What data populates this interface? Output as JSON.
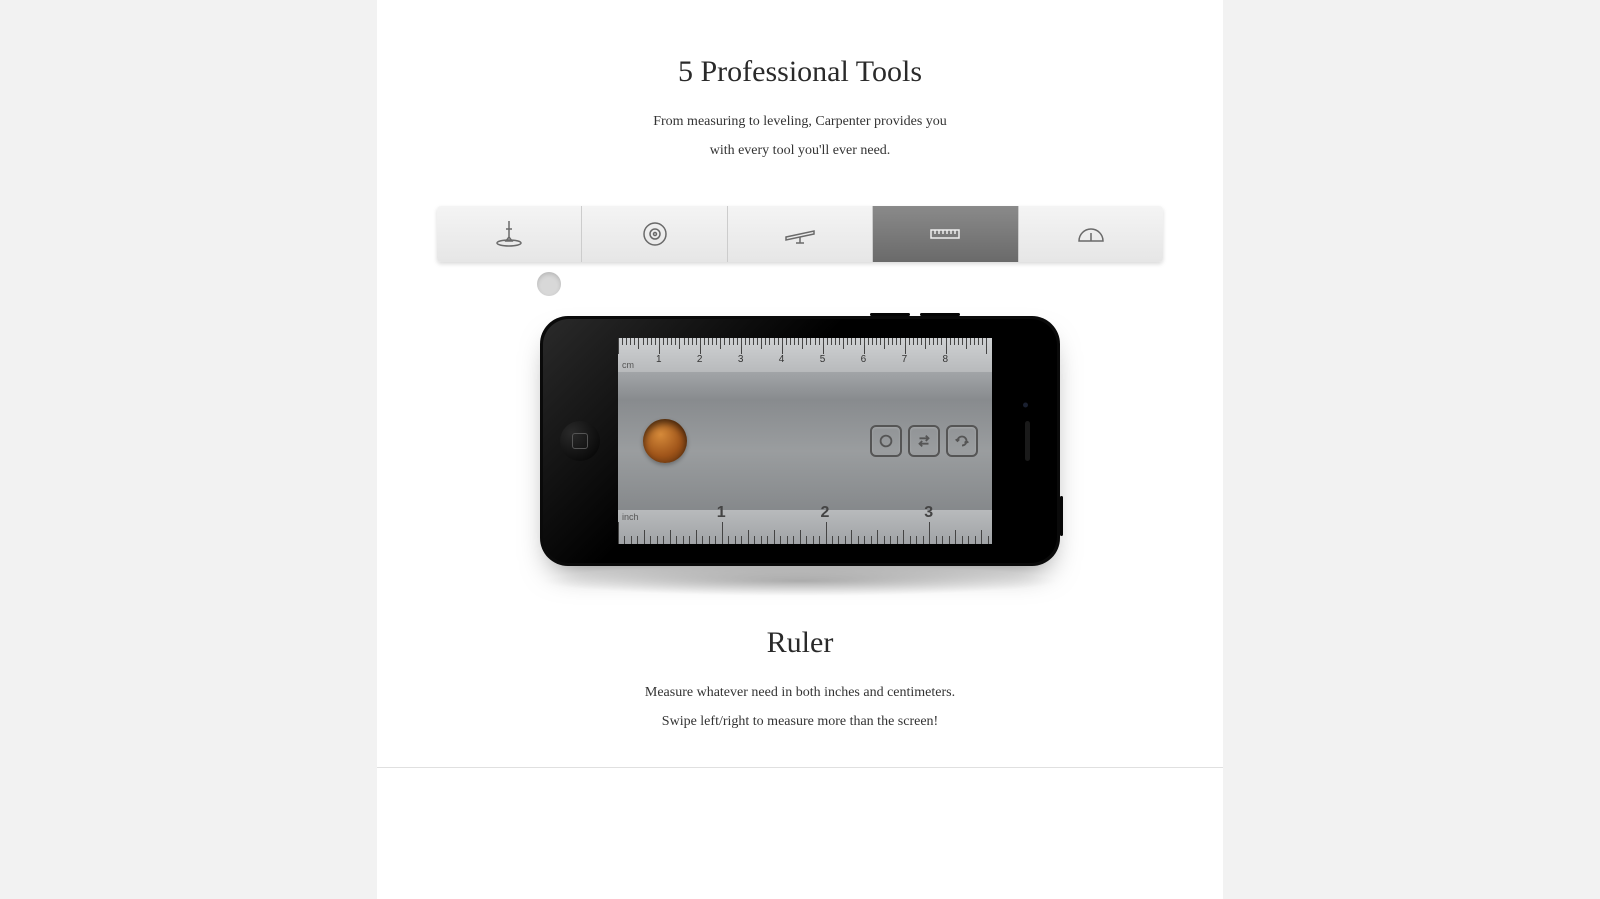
{
  "header": {
    "title": "5 Professional Tools",
    "subtitle_line1": "From measuring to leveling, Carpenter provides you",
    "subtitle_line2": "with every tool you'll ever need."
  },
  "tabs": [
    {
      "id": "plumb",
      "name": "plumb-bob-icon",
      "active": false
    },
    {
      "id": "surface",
      "name": "surface-level-icon",
      "active": false
    },
    {
      "id": "level",
      "name": "bubble-level-icon",
      "active": false
    },
    {
      "id": "ruler",
      "name": "ruler-icon",
      "active": true
    },
    {
      "id": "protractor",
      "name": "protractor-icon",
      "active": false
    }
  ],
  "ruler": {
    "top_unit": "cm",
    "top_labels": [
      "1",
      "2",
      "3",
      "4",
      "5",
      "6",
      "7",
      "8"
    ],
    "bottom_unit": "inch",
    "bottom_labels": [
      "1",
      "2",
      "3"
    ]
  },
  "feature": {
    "title": "Ruler",
    "desc_line1": "Measure whatever need in both inches and centimeters.",
    "desc_line2": "Swipe left/right to measure more than the screen!"
  }
}
